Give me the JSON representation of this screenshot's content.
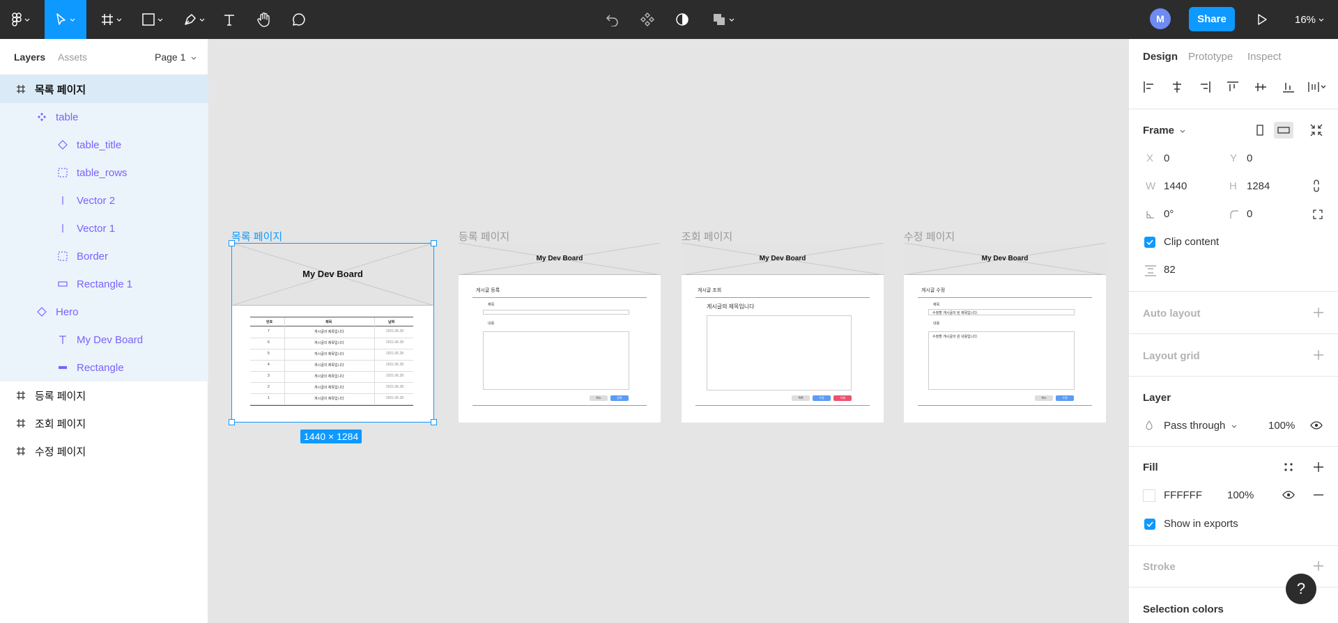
{
  "toolbar": {
    "avatar_initial": "M",
    "share_label": "Share",
    "zoom_label": "16%"
  },
  "left_panel": {
    "tabs": {
      "layers": "Layers",
      "assets": "Assets"
    },
    "page_selector": "Page 1",
    "layers": [
      "목록 페이지",
      "table",
      "table_title",
      "table_rows",
      "Vector 2",
      "Vector 1",
      "Border",
      "Rectangle 1",
      "Hero",
      "My Dev Board",
      "Rectangle",
      "등록 페이지",
      "조회 페이지",
      "수정 페이지"
    ]
  },
  "canvas": {
    "frames": {
      "list": {
        "label": "목록 페이지",
        "hero": "My Dev Board",
        "dims": "1440 × 1284"
      },
      "create": {
        "label": "등록 페이지",
        "hero": "My Dev Board",
        "heading": "게시글 등록",
        "field_title": "제목",
        "field_content": "내용",
        "btn_cancel": "취소",
        "btn_submit": "등록"
      },
      "view": {
        "label": "조회 페이지",
        "hero": "My Dev Board",
        "heading": "게시글 조회",
        "post_title": "게시글의 제목입니다",
        "btn_list": "목록",
        "btn_edit": "수정",
        "btn_delete": "삭제"
      },
      "edit": {
        "label": "수정 페이지",
        "hero": "My Dev Board",
        "heading": "게시글 수정",
        "field_title": "제목",
        "title_value": "수정할 게시글의 된 제목입니다.",
        "field_content": "내용",
        "content_value": "수정할 게시글의 원 내용입니다.",
        "btn_cancel": "취소",
        "btn_edit": "수정"
      }
    },
    "table": {
      "headers": [
        "번호",
        "제목",
        "날짜"
      ],
      "rows": [
        [
          "7",
          "게시글의 제목입니다",
          "2021.06.28"
        ],
        [
          "6",
          "게시글의 제목입니다",
          "2021.06.28"
        ],
        [
          "5",
          "게시글의 제목입니다",
          "2021.06.28"
        ],
        [
          "4",
          "게시글의 제목입니다",
          "2021.06.28"
        ],
        [
          "3",
          "게시글의 제목입니다",
          "2021.06.28"
        ],
        [
          "2",
          "게시글의 제목입니다",
          "2021.06.28"
        ],
        [
          "1",
          "게시글의 제목입니다",
          "2021.06.28"
        ]
      ]
    }
  },
  "right_panel": {
    "tabs": {
      "design": "Design",
      "prototype": "Prototype",
      "inspect": "Inspect"
    },
    "frame_label": "Frame",
    "x_label": "X",
    "x_value": "0",
    "y_label": "Y",
    "y_value": "0",
    "w_label": "W",
    "w_value": "1440",
    "h_label": "H",
    "h_value": "1284",
    "rotation_value": "0°",
    "radius_value": "0",
    "clip_content": "Clip content",
    "spacing_value": "82",
    "auto_layout": "Auto layout",
    "layout_grid": "Layout grid",
    "layer_title": "Layer",
    "blend_mode": "Pass through",
    "layer_opacity": "100%",
    "fill_title": "Fill",
    "fill_hex": "FFFFFF",
    "fill_opacity": "100%",
    "show_in_exports": "Show in exports",
    "stroke": "Stroke",
    "selection_colors": "Selection colors",
    "help": "?"
  },
  "colors": {
    "accent": "#0d99ff",
    "component_purple": "#7b61ff",
    "toolbar_bg": "#2c2c2c",
    "canvas_bg": "#e5e5e5"
  }
}
